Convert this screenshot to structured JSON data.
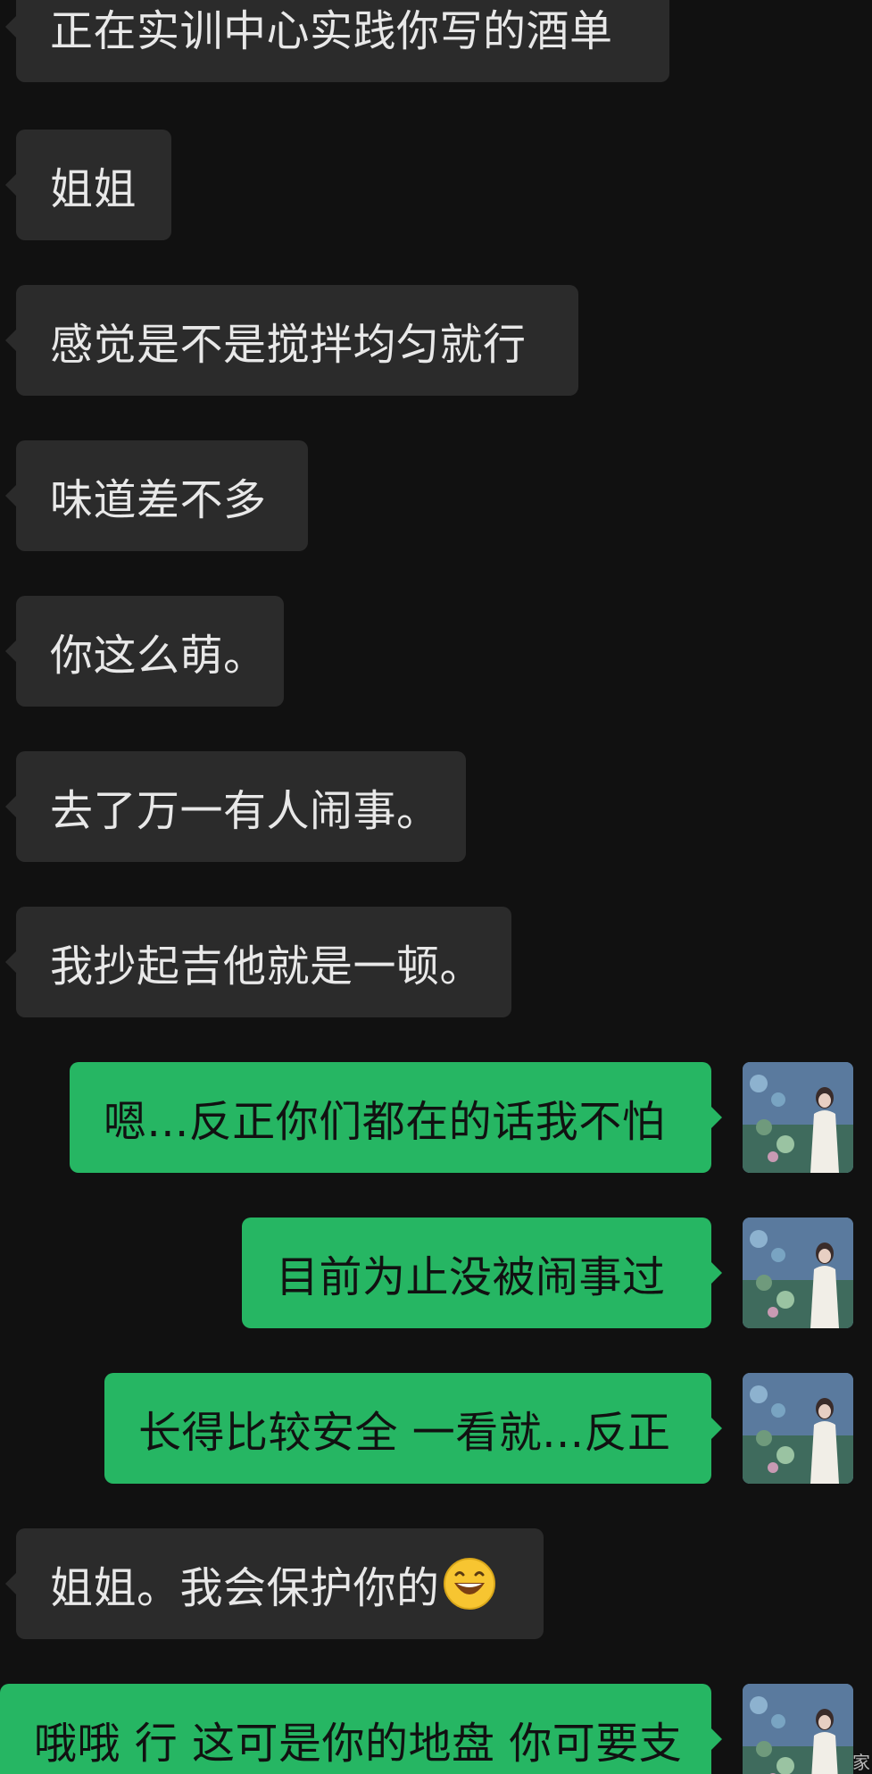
{
  "theme": {
    "background": "#111111",
    "incoming_bubble": "#2b2b2b",
    "outgoing_bubble": "#26b663",
    "incoming_text": "#e8e8e8",
    "outgoing_text": "#111111"
  },
  "messages": [
    {
      "direction": "incoming",
      "text": "正在实训中心实践你写的酒单"
    },
    {
      "direction": "incoming",
      "text": "姐姐"
    },
    {
      "direction": "incoming",
      "text": "感觉是不是搅拌均匀就行"
    },
    {
      "direction": "incoming",
      "text": "味道差不多"
    },
    {
      "direction": "incoming",
      "text": "你这么萌。"
    },
    {
      "direction": "incoming",
      "text": "去了万一有人闹事。"
    },
    {
      "direction": "incoming",
      "text": "我抄起吉他就是一顿。"
    },
    {
      "direction": "outgoing",
      "text": "嗯...反正你们都在的话我不怕",
      "avatar": "user-avatar"
    },
    {
      "direction": "outgoing",
      "text": "目前为止没被闹事过",
      "avatar": "user-avatar"
    },
    {
      "direction": "outgoing",
      "text": "长得比较安全 一看就...反正",
      "avatar": "user-avatar"
    },
    {
      "direction": "incoming",
      "text": "姐姐。我会保护你的",
      "emoji": "grinning-face-emoji"
    },
    {
      "direction": "outgoing",
      "text": "哦哦 行 这可是你的地盘 你可要支",
      "avatar": "user-avatar"
    }
  ],
  "footer": {
    "partial_text": "家"
  }
}
